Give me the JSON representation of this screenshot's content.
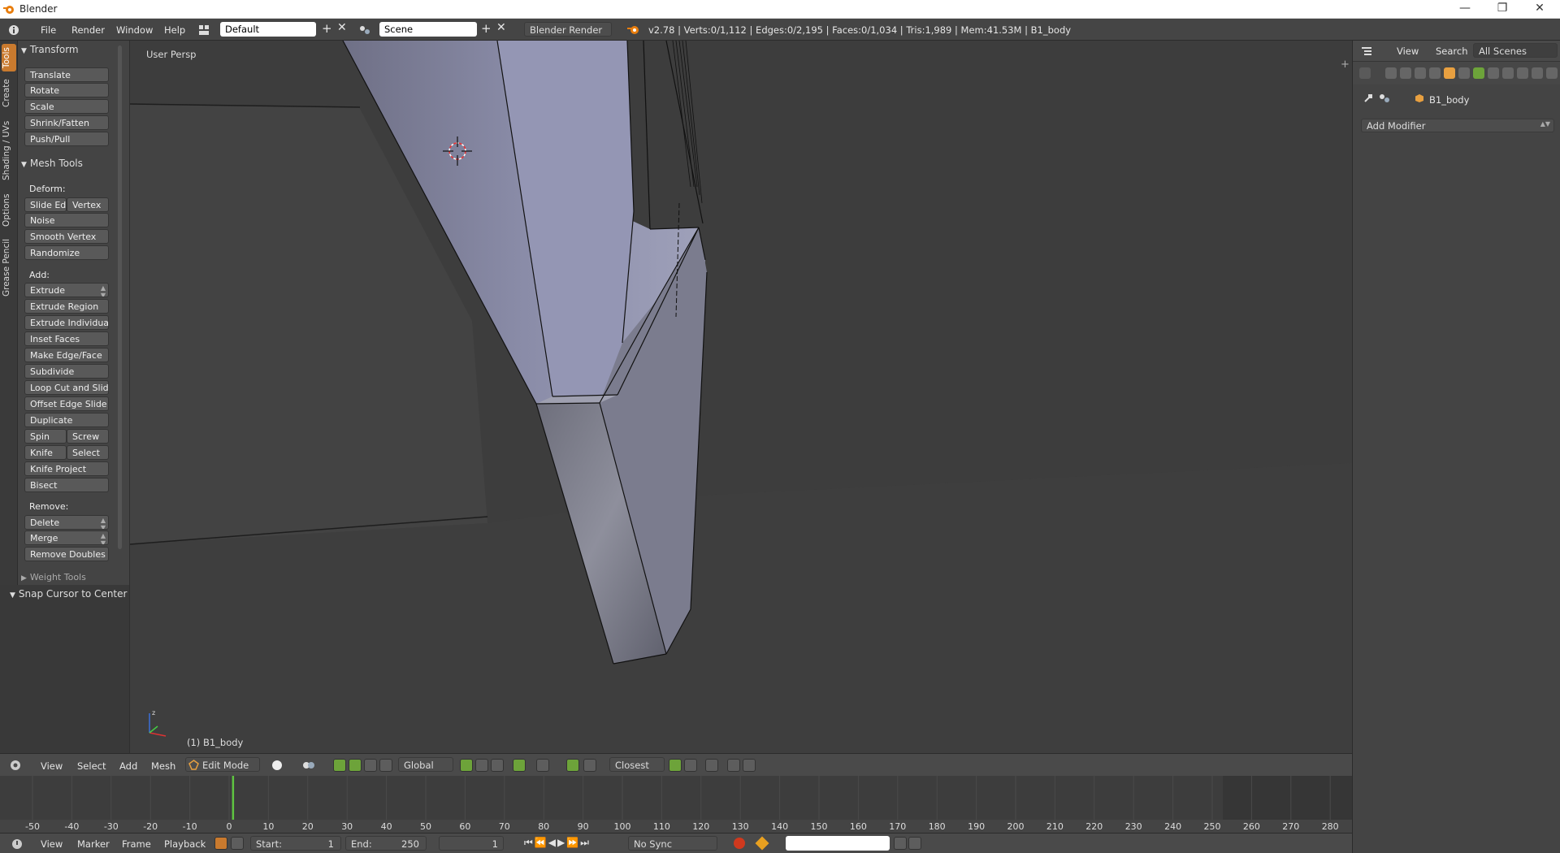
{
  "window": {
    "title": "Blender"
  },
  "topbar": {
    "menus": [
      "File",
      "Render",
      "Window",
      "Help"
    ],
    "screen_layout": "Default",
    "scene": "Scene",
    "render_engine": "Blender Render",
    "stats": "v2.78 | Verts:0/1,112 | Edges:0/2,195 | Faces:0/1,034 | Tris:1,989 | Mem:41.53M | B1_body"
  },
  "left_tabs": [
    "Tools",
    "Create",
    "Shading / UVs",
    "Options",
    "Grease Pencil"
  ],
  "toolshelf": {
    "transform_header": "Transform",
    "transform_buttons": [
      "Translate",
      "Rotate",
      "Scale",
      "Shrink/Fatten",
      "Push/Pull"
    ],
    "mesh_tools_header": "Mesh Tools",
    "deform_label": "Deform:",
    "slide_edge": "Slide Ed",
    "vertex": "Vertex",
    "noise": "Noise",
    "smooth_vertex": "Smooth Vertex",
    "randomize": "Randomize",
    "add_label": "Add:",
    "extrude": "Extrude",
    "extrude_region": "Extrude Region",
    "extrude_individual": "Extrude Individual",
    "inset_faces": "Inset Faces",
    "make_edge_face": "Make Edge/Face",
    "subdivide": "Subdivide",
    "loop_cut": "Loop Cut and Slide",
    "offset_edge": "Offset Edge Slide",
    "duplicate": "Duplicate",
    "spin": "Spin",
    "screw": "Screw",
    "knife": "Knife",
    "select": "Select",
    "knife_project": "Knife Project",
    "bisect": "Bisect",
    "remove_label": "Remove:",
    "delete": "Delete",
    "merge": "Merge",
    "remove_doubles": "Remove Doubles",
    "weight_tools": "Weight Tools"
  },
  "snap_panel": {
    "title": "Snap Cursor to Center"
  },
  "viewport": {
    "label": "User Persp",
    "object": "(1) B1_body"
  },
  "view3d_header": {
    "menus": [
      "View",
      "Select",
      "Add",
      "Mesh"
    ],
    "mode": "Edit Mode",
    "orientation": "Global",
    "snap_target": "Closest"
  },
  "timeline": {
    "ticks": [
      -50,
      -40,
      -30,
      -20,
      -10,
      0,
      10,
      20,
      30,
      40,
      50,
      60,
      70,
      80,
      90,
      100,
      110,
      120,
      130,
      140,
      150,
      160,
      170,
      180,
      190,
      200,
      210,
      220,
      230,
      240,
      250,
      260,
      270,
      280
    ],
    "current_frame": 1,
    "menus": [
      "View",
      "Marker",
      "Frame",
      "Playback"
    ],
    "start_label": "Start:",
    "start_value": "1",
    "end_label": "End:",
    "end_value": "250",
    "frame_value": "1",
    "sync": "No Sync"
  },
  "properties": {
    "menus": [
      "View",
      "Search"
    ],
    "scope": "All Scenes",
    "object_name": "B1_body",
    "add_modifier": "Add Modifier"
  },
  "colors": {
    "accent_orange": "#c97a2e",
    "active_green": "#6da33a",
    "frame_line": "#5fc441"
  }
}
